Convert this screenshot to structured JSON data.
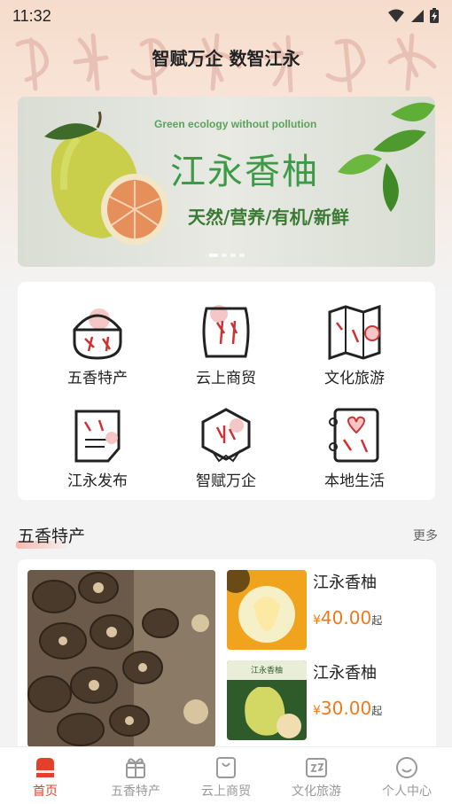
{
  "status_bar": {
    "time": "11:32"
  },
  "header": {
    "title": "智赋万企 数智江永"
  },
  "banner": {
    "en_text": "Green ecology without pollution",
    "title": "江永香柚",
    "subtitle": "天然/营养/有机/新鲜"
  },
  "grid": {
    "items": [
      {
        "label": "五香特产",
        "icon": "specialty-basket-icon"
      },
      {
        "label": "云上商贸",
        "icon": "cloud-shopping-icon"
      },
      {
        "label": "文化旅游",
        "icon": "map-location-icon"
      },
      {
        "label": "江永发布",
        "icon": "document-publish-icon"
      },
      {
        "label": "智赋万企",
        "icon": "enterprise-badge-icon"
      },
      {
        "label": "本地生活",
        "icon": "local-life-notebook-icon"
      }
    ]
  },
  "section": {
    "title": "五香特产",
    "more": "更多"
  },
  "products": [
    {
      "name": "江永香柚",
      "currency": "¥",
      "price": "40.00",
      "suffix": "起"
    },
    {
      "name": "江永香柚",
      "currency": "¥",
      "price": "30.00",
      "suffix": "起"
    }
  ],
  "tab_bar": {
    "tabs": [
      {
        "label": "首页",
        "icon": "home-icon",
        "active": true
      },
      {
        "label": "五香特产",
        "icon": "gift-icon"
      },
      {
        "label": "云上商贸",
        "icon": "shopping-bag-icon"
      },
      {
        "label": "文化旅游",
        "icon": "travel-icon"
      },
      {
        "label": "个人中心",
        "icon": "user-smile-icon"
      }
    ]
  },
  "colors": {
    "accent": "#e2402b",
    "price": "#f07a1a",
    "banner_green": "#3d9a48"
  }
}
